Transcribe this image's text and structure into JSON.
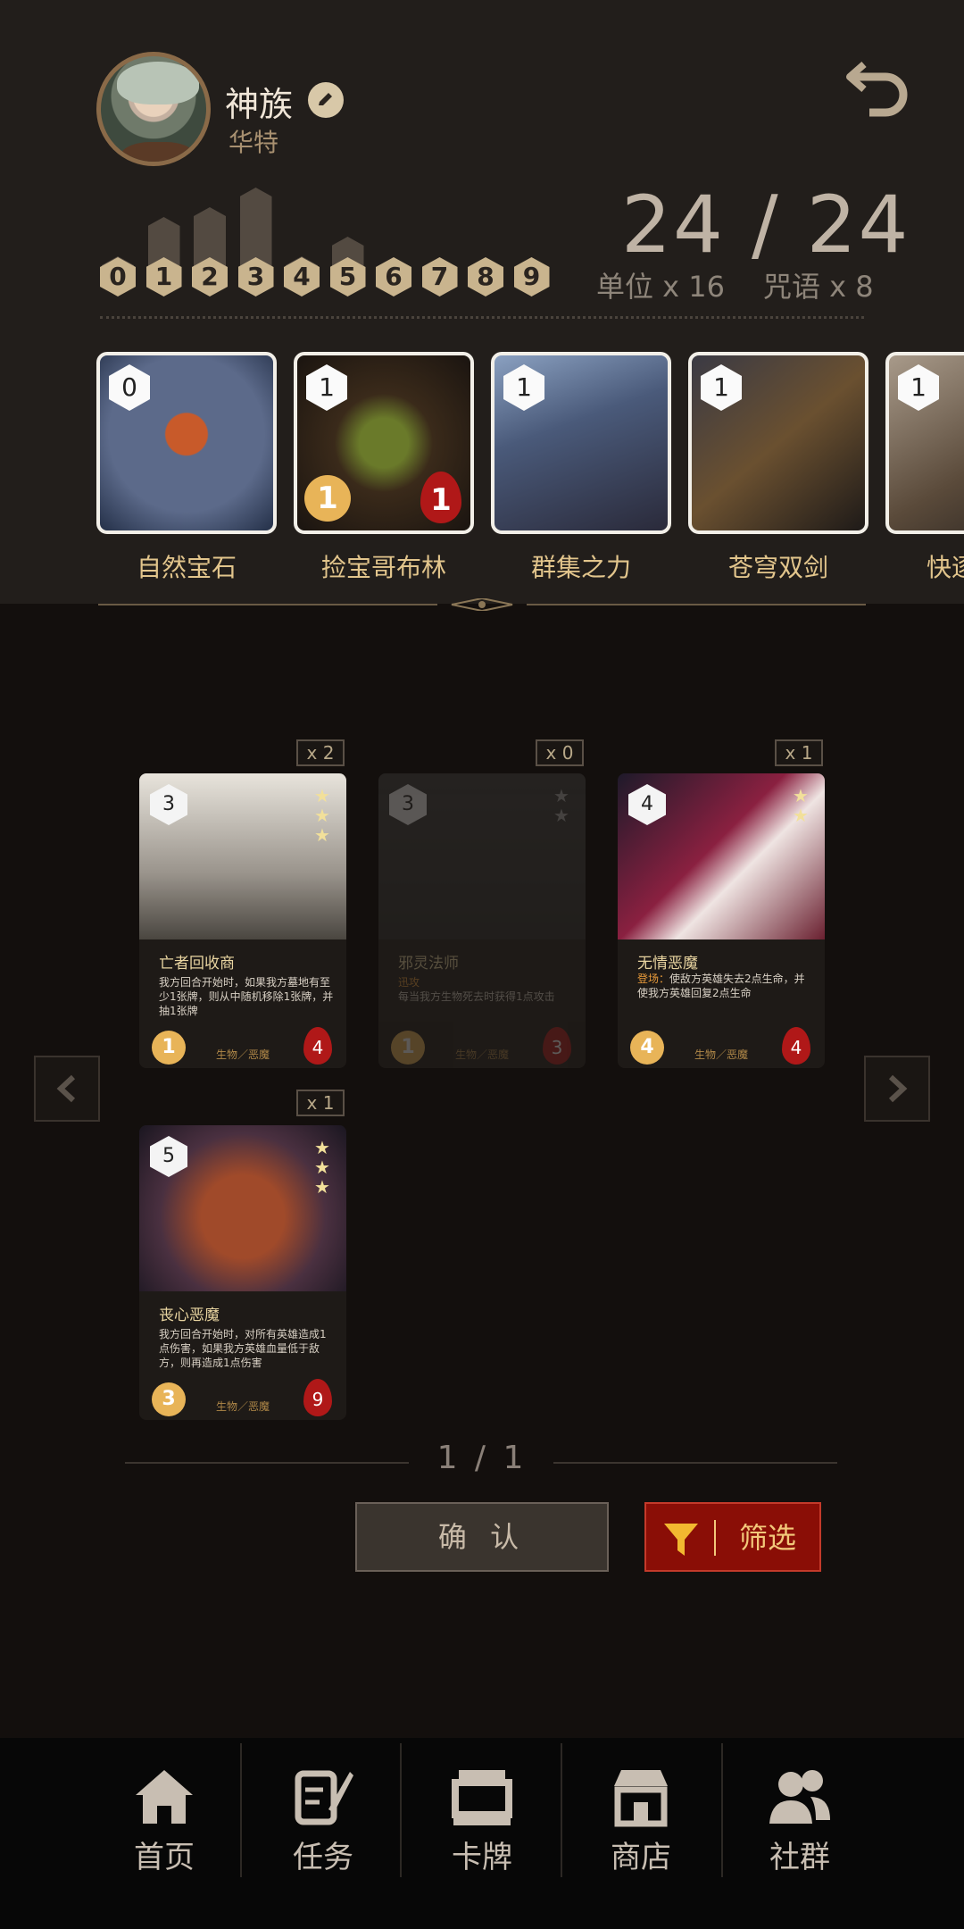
{
  "profile": {
    "faction": "神族",
    "hero": "华特"
  },
  "cost_curve": {
    "labels": [
      "0",
      "1",
      "2",
      "3",
      "4",
      "5",
      "6",
      "7",
      "8",
      "9"
    ],
    "counts": [
      1,
      5,
      6,
      8,
      1,
      3,
      0,
      0,
      0,
      0
    ]
  },
  "deck": {
    "count": "24 / 24",
    "units": "单位 x 16",
    "spells": "咒语 x 8",
    "cards": [
      {
        "name": "自然宝石",
        "cost": "0"
      },
      {
        "name": "捡宝哥布林",
        "cost": "1",
        "atk": "1",
        "hp": "1"
      },
      {
        "name": "群集之力",
        "cost": "1"
      },
      {
        "name": "苍穹双剑",
        "cost": "1"
      },
      {
        "name": "快逐",
        "cost": "1"
      }
    ]
  },
  "collection": {
    "cards": [
      {
        "copies": "x 2",
        "cost": "3",
        "name": "亡者回收商",
        "desc": "我方回合开始时，如果我方墓地有至少1张牌，则从中随机移除1张牌，并抽1张牌",
        "type": "生物／恶魔",
        "atk": "1",
        "hp": "4",
        "stars": 3
      },
      {
        "copies": "x 0",
        "cost": "3",
        "name": "邪灵法师",
        "keyword": "迅攻",
        "desc": "每当我方生物死去时获得1点攻击",
        "type": "生物／恶魔",
        "atk": "1",
        "hp": "3",
        "stars": 2
      },
      {
        "copies": "x 1",
        "cost": "4",
        "name": "无情恶魔",
        "keyword": "登场：",
        "desc": "使敌方英雄失去2点生命，并使我方英雄回复2点生命",
        "type": "生物／恶魔",
        "atk": "4",
        "hp": "4",
        "stars": 2
      },
      {
        "copies": "x 1",
        "cost": "5",
        "name": "丧心恶魔",
        "desc": "我方回合开始时，对所有英雄造成1点伤害，如果我方英雄血量低于敌方，则再造成1点伤害",
        "type": "生物／恶魔",
        "atk": "3",
        "hp": "9",
        "stars": 3
      }
    ]
  },
  "pagination": {
    "page": "1 / 1"
  },
  "buttons": {
    "confirm": "确 认",
    "filter": "筛选"
  },
  "bottom_nav": {
    "items": [
      {
        "label": "首页",
        "icon": "home-icon"
      },
      {
        "label": "任务",
        "icon": "quest-icon"
      },
      {
        "label": "卡牌",
        "icon": "cards-icon"
      },
      {
        "label": "商店",
        "icon": "shop-icon"
      },
      {
        "label": "社群",
        "icon": "community-icon"
      }
    ]
  },
  "colors": {
    "accent": "#e2c58c",
    "filter_bg": "#8a0e06",
    "panel": "#221e1b"
  }
}
